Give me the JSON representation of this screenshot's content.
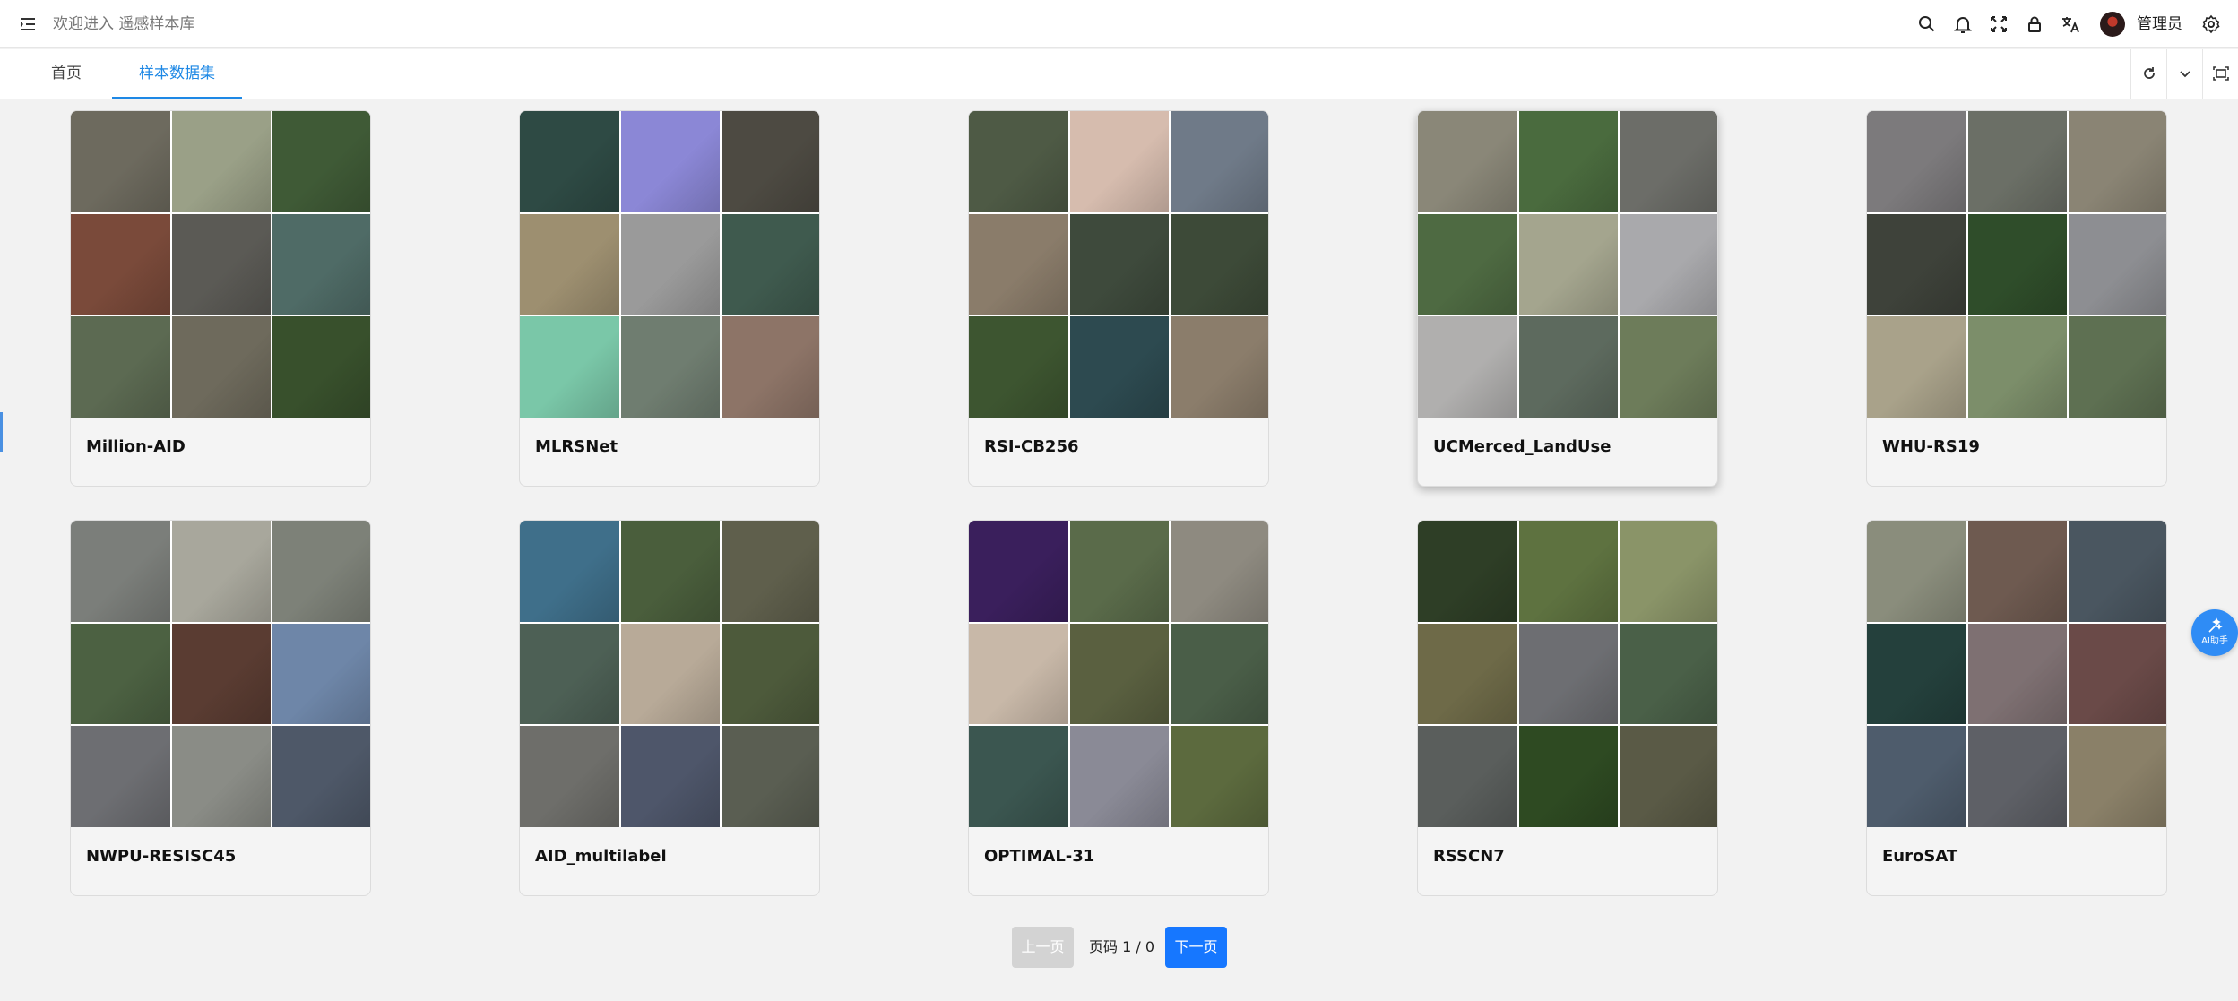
{
  "header": {
    "welcome": "欢迎进入 遥感样本库",
    "user_name": "管理员",
    "icons": [
      "menu-fold-icon",
      "search-icon",
      "bell-icon",
      "fullscreen-icon",
      "lock-icon",
      "translate-icon",
      "avatar",
      "settings-icon"
    ]
  },
  "tabs": [
    {
      "label": "首页",
      "active": false
    },
    {
      "label": "样本数据集",
      "active": true
    }
  ],
  "tab_actions": [
    "refresh-icon",
    "chevron-down-icon",
    "fit-screen-icon"
  ],
  "datasets": [
    {
      "name": "Million-AID",
      "thumbs": [
        "#6d6a5e",
        "#9aa087",
        "#3f5a36",
        "#7a4a3a",
        "#5b5a55",
        "#4f6b66",
        "#5c6a52",
        "#6e6a5c",
        "#38502c"
      ]
    },
    {
      "name": "MLRSNet",
      "thumbs": [
        "#2e4a44",
        "#8b87d6",
        "#4d4a42",
        "#9d8f70",
        "#9a9a9a",
        "#3f5a4e",
        "#7ac7a8",
        "#6f7d70",
        "#8d7467"
      ]
    },
    {
      "name": "RSI-CB256",
      "thumbs": [
        "#4e5a45",
        "#d6bcae",
        "#6f7a88",
        "#8a7c6a",
        "#3e4a3c",
        "#3d4a38",
        "#3d5530",
        "#2d4a50",
        "#8b7d6b"
      ]
    },
    {
      "name": "UCMerced_LandUse",
      "thumbs": [
        "#8a8778",
        "#4a6b3e",
        "#6c6d68",
        "#4e6a42",
        "#a4a58e",
        "#a9a9ac",
        "#b0afae",
        "#5d6a5e",
        "#6d7c5a"
      ]
    },
    {
      "name": "WHU-RS19",
      "thumbs": [
        "#7c7a7c",
        "#6b6f66",
        "#8a8474",
        "#3e423a",
        "#2f4d2a",
        "#8d8e92",
        "#a9a28a",
        "#7c8e6a",
        "#5e7052"
      ]
    },
    {
      "name": "NWPU-RESISC45",
      "thumbs": [
        "#7b7e7a",
        "#a8a79c",
        "#7d8178",
        "#4c6142",
        "#5a3c32",
        "#6e86a8",
        "#6d6e72",
        "#8a8c86",
        "#4e5868"
      ]
    },
    {
      "name": "AID_multilabel",
      "thumbs": [
        "#3f6f8a",
        "#4a5e3c",
        "#5f5f4c",
        "#4d6055",
        "#b8aa98",
        "#4d5a3b",
        "#6e6e6a",
        "#4e566a",
        "#5a5e52"
      ]
    },
    {
      "name": "OPTIMAL-31",
      "thumbs": [
        "#3a1f5c",
        "#5a6b4a",
        "#8e8a80",
        "#c8b8a8",
        "#5a6040",
        "#4a5e48",
        "#3b5650",
        "#8a8a96",
        "#5c6a3e"
      ]
    },
    {
      "name": "RSSCN7",
      "thumbs": [
        "#2e3e26",
        "#5e7240",
        "#8a9468",
        "#6e6a48",
        "#6d6e72",
        "#4a6048",
        "#5a5e5c",
        "#2e4a22",
        "#5a5a46"
      ]
    },
    {
      "name": "EuroSAT",
      "thumbs": [
        "#8a8d7c",
        "#6e5a50",
        "#4a5660",
        "#24403c",
        "#7e7072",
        "#6a4a48",
        "#4e5c6c",
        "#5e6066",
        "#8a8068"
      ]
    }
  ],
  "pagination": {
    "prev_label": "上一页",
    "page_info": "页码 1 / 0",
    "next_label": "下一页"
  },
  "ai_assistant": {
    "label": "AI助手"
  }
}
